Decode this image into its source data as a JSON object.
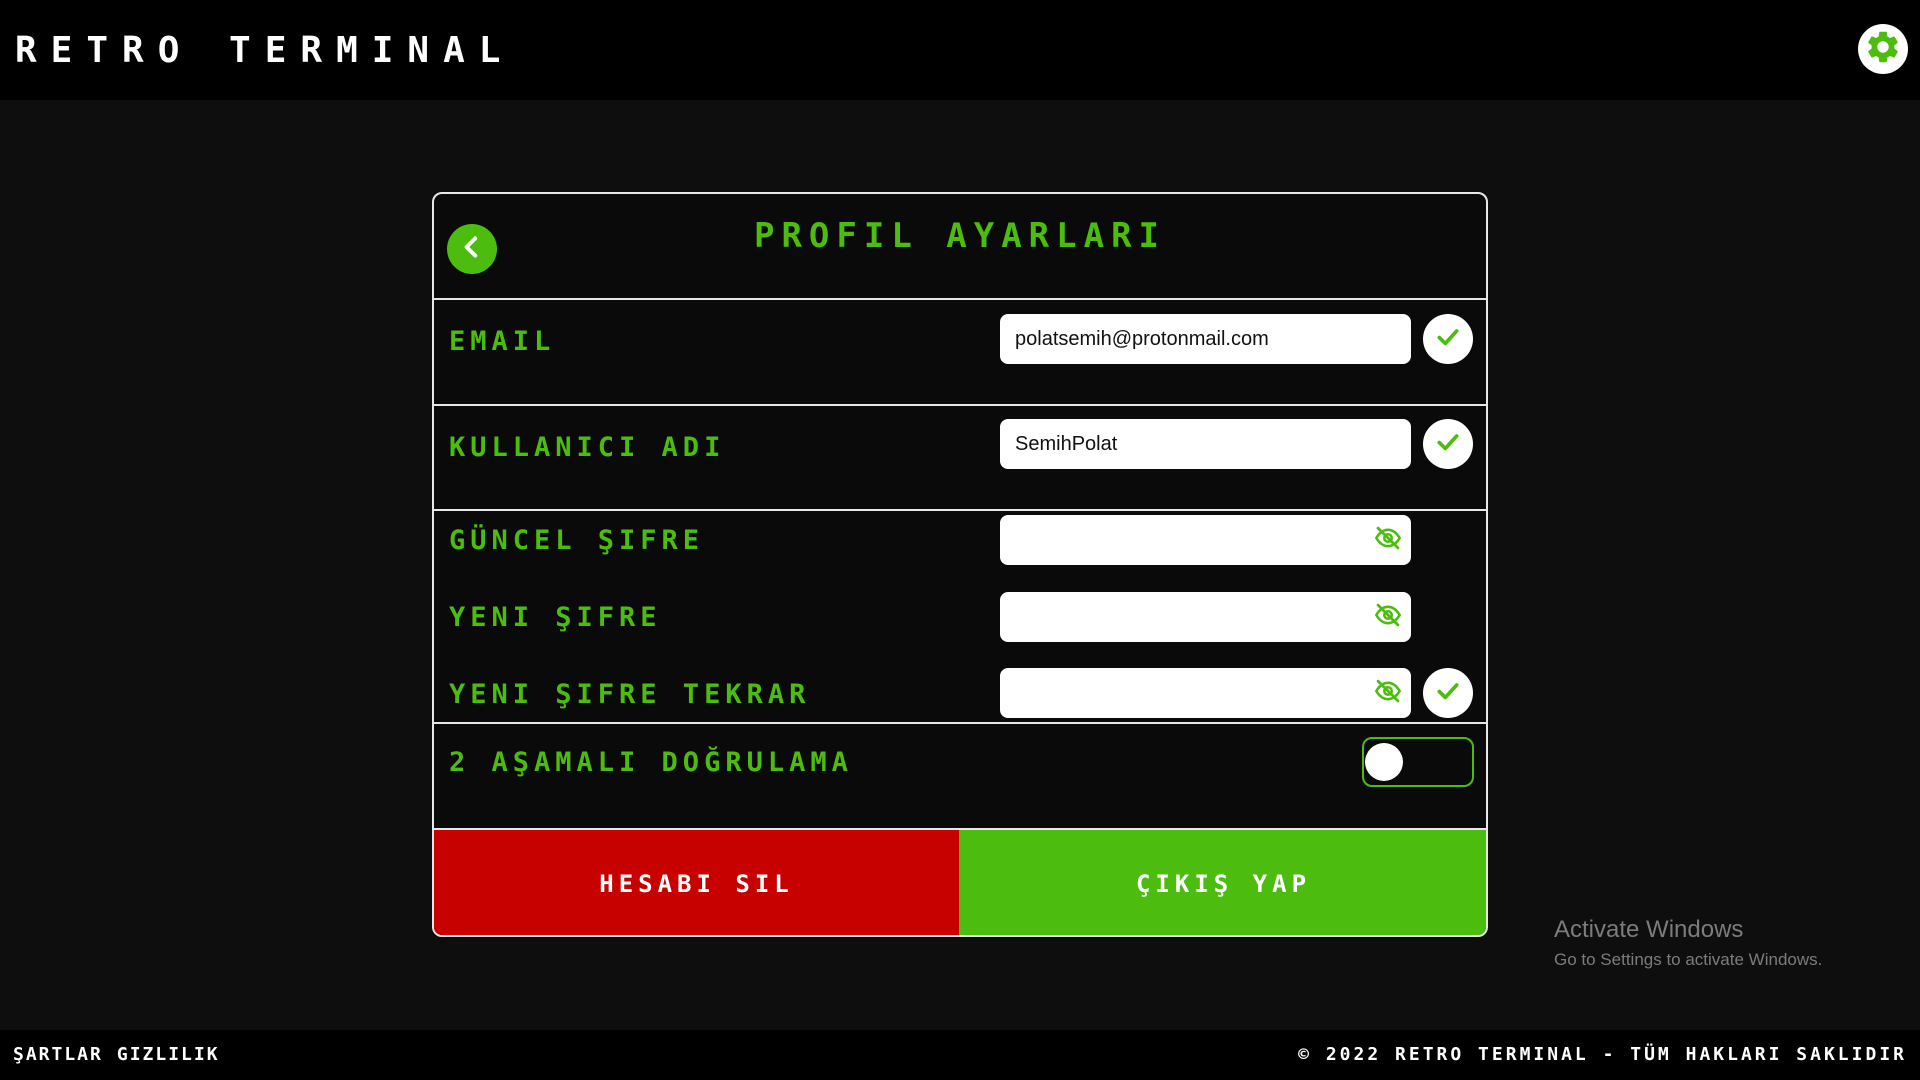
{
  "app": {
    "brand": "Retro Terminal"
  },
  "header": {
    "settings_icon": "gear-icon"
  },
  "card": {
    "title": "Profil Ayarları",
    "back_icon": "chevron-left-icon",
    "email": {
      "label": "Email",
      "value": "polatsemih@protonmail.com",
      "status_icon": "check-icon"
    },
    "username": {
      "label": "Kullanıcı Adı",
      "value": "SemihPolat",
      "status_icon": "check-icon"
    },
    "current_password": {
      "label": "Güncel Şifre",
      "value": "",
      "visibility_icon": "eye-off-icon"
    },
    "new_password": {
      "label": "Yeni Şifre",
      "value": "",
      "visibility_icon": "eye-off-icon"
    },
    "new_password_repeat": {
      "label": "Yeni Şifre Tekrar",
      "value": "",
      "visibility_icon": "eye-off-icon",
      "status_icon": "check-icon"
    },
    "two_factor": {
      "label": "2 Aşamalı Doğrulama",
      "enabled": false
    },
    "delete_label": "Hesabı Sil",
    "logout_label": "Çıkış Yap"
  },
  "watermark": {
    "title": "Activate Windows",
    "subtitle": "Go to Settings to activate Windows."
  },
  "footer": {
    "links": [
      "Şartlar",
      "Gizlilik"
    ],
    "copyright": "© 2022 Retro Terminal - Tüm Hakları Saklıdır"
  },
  "colors": {
    "accent": "#4cbd0e",
    "danger": "#c70000",
    "background": "#0e0e0e",
    "bar": "#000000"
  }
}
